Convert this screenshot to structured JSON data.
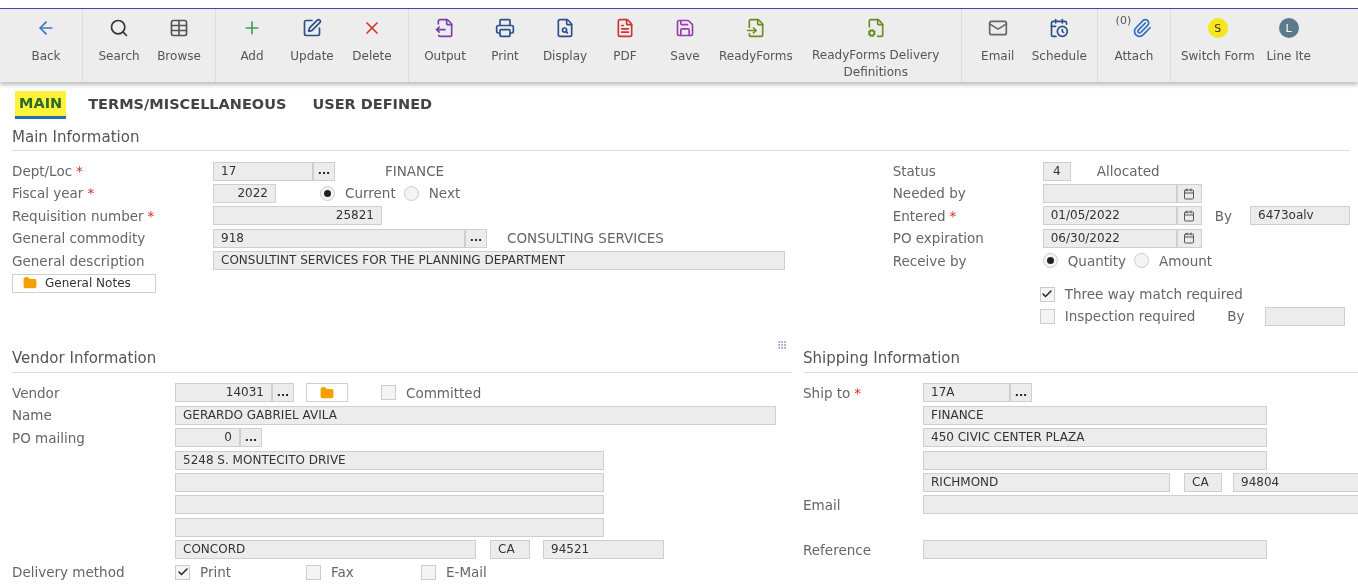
{
  "toolbar": [
    {
      "items": [
        {
          "label": "Back"
        }
      ]
    },
    {
      "items": [
        {
          "label": "Search"
        },
        {
          "label": "Browse"
        }
      ]
    },
    {
      "items": [
        {
          "label": "Add"
        },
        {
          "label": "Update"
        },
        {
          "label": "Delete"
        }
      ]
    },
    {
      "items": [
        {
          "label": "Output"
        },
        {
          "label": "Print"
        },
        {
          "label": "Display"
        },
        {
          "label": "PDF"
        },
        {
          "label": "Save"
        },
        {
          "label": "ReadyForms"
        },
        {
          "label": "ReadyForms Delivery Definitions"
        }
      ]
    },
    {
      "items": [
        {
          "label": "Email"
        },
        {
          "label": "Schedule"
        }
      ]
    },
    {
      "items": [
        {
          "label": "Attach",
          "count": "(0)"
        }
      ]
    },
    {
      "items": [
        {
          "badge": "S",
          "color": "#f7e51e",
          "label": "Switch Form"
        },
        {
          "badge": "L",
          "color": "#5b7a8a",
          "label": "Line Ite"
        }
      ]
    }
  ],
  "tabs": [
    {
      "label": "MAIN",
      "selected": true
    },
    {
      "label": "TERMS/MISCELLANEOUS",
      "selected": false
    },
    {
      "label": "USER DEFINED",
      "selected": false
    }
  ],
  "main_information": {
    "title": "Main Information",
    "dept_loc": {
      "label": "Dept/Loc",
      "mark": "*",
      "value": "17",
      "lookup": "...",
      "description": "FINANCE"
    },
    "fiscal_year": {
      "label": "Fiscal year",
      "mark": "*",
      "value": "2022",
      "options": [
        {
          "label": "Current",
          "selected": true
        },
        {
          "label": "Next",
          "selected": false
        }
      ]
    },
    "requisition_number": {
      "label": "Requisition number",
      "mark": "*",
      "value": "25821"
    },
    "general_commodity": {
      "label": "General commodity",
      "value": "918",
      "lookup": "...",
      "description": "CONSULTING SERVICES"
    },
    "general_description": {
      "label": "General description",
      "value": "CONSULTINT SERVICES FOR THE PLANNING DEPARTMENT"
    },
    "general_notes_button": "General Notes",
    "status": {
      "label": "Status",
      "value": "4",
      "description": "Allocated"
    },
    "needed_by": {
      "label": "Needed by"
    },
    "entered": {
      "label": "Entered",
      "mark": "*",
      "value": "01/05/2022",
      "by_label": "By",
      "by_value": "6473oalv"
    },
    "po_expiration": {
      "label": "PO expiration",
      "value": "06/30/2022"
    },
    "receive_by": {
      "label": "Receive by",
      "options": [
        {
          "label": "Quantity",
          "selected": true
        },
        {
          "label": "Amount",
          "selected": false
        }
      ]
    },
    "three_way_match": {
      "label": "Three way match required",
      "checked": true
    },
    "inspection": {
      "label": "Inspection required",
      "checked": false,
      "by_label": "By"
    }
  },
  "vendor_information": {
    "title": "Vendor Information",
    "vendor": {
      "label": "Vendor",
      "value": "14031",
      "lookup": "...",
      "committed": {
        "label": "Committed",
        "checked": false
      }
    },
    "name": {
      "label": "Name",
      "value": "GERARDO GABRIEL AVILA"
    },
    "po_mailing": {
      "label": "PO mailing",
      "value": "0",
      "lookup": "...",
      "address_lines": [
        "5248 S. MONTECITO DRIVE"
      ],
      "city": "CONCORD",
      "state": "CA",
      "zip": "94521"
    },
    "delivery_method": {
      "label": "Delivery method",
      "options": [
        {
          "label": "Print",
          "checked": true
        },
        {
          "label": "Fax",
          "checked": false
        },
        {
          "label": "E-Mail",
          "checked": false
        }
      ]
    }
  },
  "shipping_information": {
    "title": "Shipping Information",
    "ship_to": {
      "label": "Ship to",
      "mark": "*",
      "value": "17A",
      "lookup": "...",
      "address_lines": [
        "FINANCE",
        "450 CIVIC CENTER PLAZA"
      ],
      "city": "RICHMOND",
      "state": "CA",
      "zip": "94804"
    },
    "email": {
      "label": "Email"
    },
    "reference": {
      "label": "Reference"
    }
  }
}
